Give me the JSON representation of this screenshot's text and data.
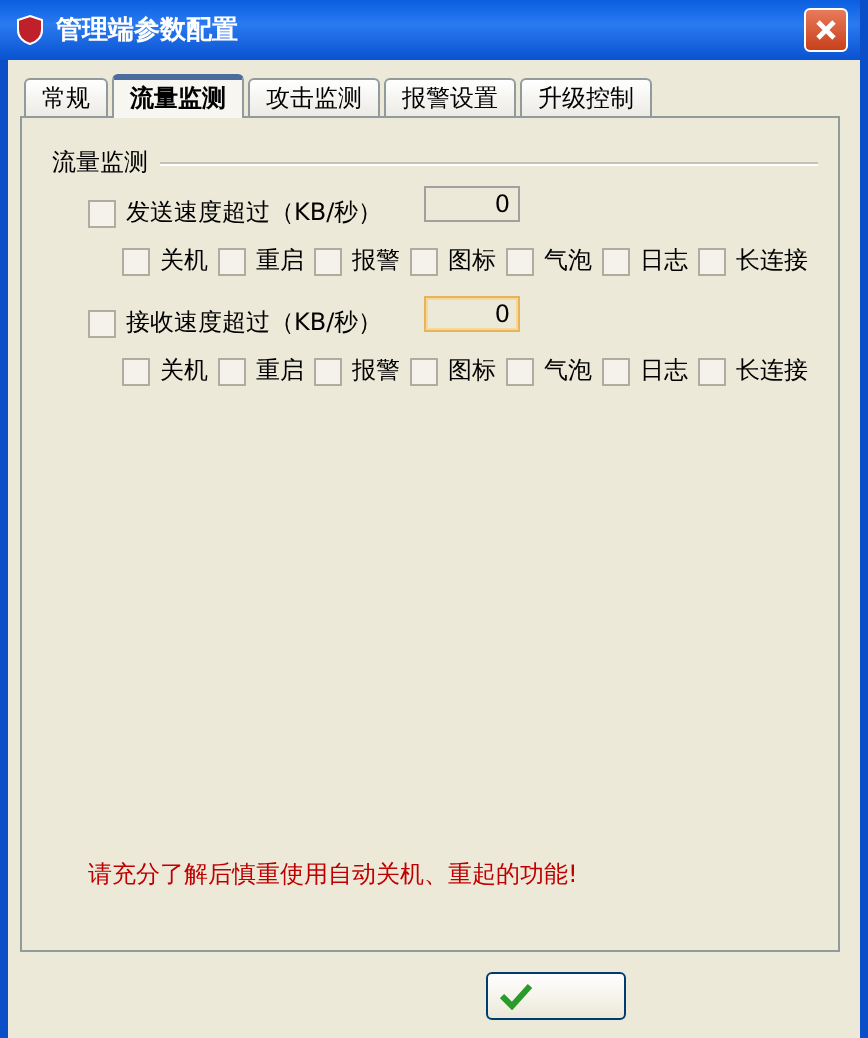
{
  "window": {
    "title": "管理端参数配置"
  },
  "tabs": [
    {
      "label": "常规",
      "selected": false
    },
    {
      "label": "流量监测",
      "selected": true
    },
    {
      "label": "攻击监测",
      "selected": false
    },
    {
      "label": "报警设置",
      "selected": false
    },
    {
      "label": "升级控制",
      "selected": false
    }
  ],
  "group": {
    "title": "流量监测",
    "rules": [
      {
        "label": "发送速度超过（KB/秒）",
        "checked": false,
        "value": "0",
        "focused": false,
        "actions": [
          {
            "label": "关机",
            "checked": false
          },
          {
            "label": "重启",
            "checked": false
          },
          {
            "label": "报警",
            "checked": false
          },
          {
            "label": "图标",
            "checked": false
          },
          {
            "label": "气泡",
            "checked": false
          },
          {
            "label": "日志",
            "checked": false
          },
          {
            "label": "长连接",
            "checked": false
          }
        ]
      },
      {
        "label": "接收速度超过（KB/秒）",
        "checked": false,
        "value": "0",
        "focused": true,
        "actions": [
          {
            "label": "关机",
            "checked": false
          },
          {
            "label": "重启",
            "checked": false
          },
          {
            "label": "报警",
            "checked": false
          },
          {
            "label": "图标",
            "checked": false
          },
          {
            "label": "气泡",
            "checked": false
          },
          {
            "label": "日志",
            "checked": false
          },
          {
            "label": "长连接",
            "checked": false
          }
        ]
      }
    ]
  },
  "warning": "请充分了解后慎重使用自动关机、重起的功能!",
  "buttons": [
    {
      "kind": "ok"
    }
  ]
}
